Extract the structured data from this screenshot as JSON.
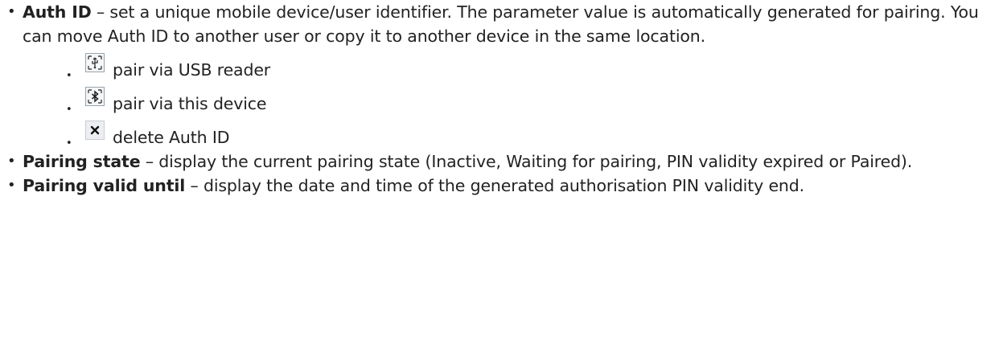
{
  "items": [
    {
      "term": "Auth ID",
      "text": " – set a unique mobile device/user identifier. The parameter value is automatically generated for pairing. You can move Auth ID to another user or copy it to another device in the same location.",
      "sub": [
        {
          "icon": "usb-pair-icon",
          "label": "pair via USB reader"
        },
        {
          "icon": "bluetooth-pair-icon",
          "label": "pair via this device"
        },
        {
          "icon": "delete-icon",
          "label": "delete Auth ID"
        }
      ]
    },
    {
      "term": "Pairing state",
      "text": " – display the current pairing state (Inactive, Waiting for pairing, PIN validity expired or Paired)."
    },
    {
      "term": "Pairing valid until",
      "text": " – display the date and time of the generated authorisation PIN validity end."
    }
  ]
}
